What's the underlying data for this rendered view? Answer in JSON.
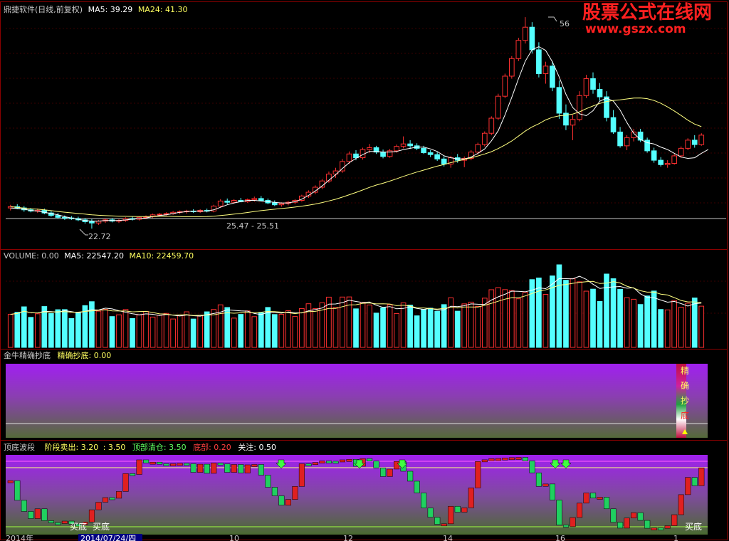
{
  "watermark": {
    "title": "股票公式在线网",
    "url": "www.gszx.com"
  },
  "panel_main": {
    "title": "鼎捷软件(日线,前复权)",
    "ma5_label": "MA5: 39.29",
    "ma24_label": "MA24: 41.30",
    "annotation_range": "25.47 - 25.51",
    "annotation_low": "22.72",
    "annotation_high": "56",
    "colors": {
      "ma5": "#ffffff",
      "ma24": "#ffff80",
      "up": "#ff3030",
      "down": "#54ffff"
    }
  },
  "panel_volume": {
    "title": "VOLUME: 0.00",
    "ma5_label": "MA5: 22547.20",
    "ma10_label": "MA10: 22459.70"
  },
  "panel_jingque": {
    "title": "金牛精确抄底",
    "value_label": "精确抄底: 0.00",
    "side_chars": [
      "精",
      "确",
      "抄",
      "底"
    ]
  },
  "panel_wave": {
    "title": "顶底波段",
    "stage_sell_label": "阶段卖出: 3.20",
    "stage_sell_value": ": 3.50",
    "top_clear_label": "顶部清仓: 3.50",
    "bottom_label": "底部: 0.20",
    "watch_label": "关注: 0.50",
    "buy_labels": [
      "买底",
      "买底",
      "买底"
    ]
  },
  "x_axis": {
    "labels": [
      "2014年",
      "2014/07/24/四",
      "10",
      "12",
      "14",
      "16",
      "1"
    ]
  },
  "chart_data": {
    "type": "candlestick",
    "candles_ohlc": [
      [
        26,
        26.5,
        25.6,
        26.2
      ],
      [
        26.2,
        26.6,
        25.8,
        26
      ],
      [
        26,
        26.3,
        25.4,
        25.7
      ],
      [
        25.7,
        26,
        25.3,
        25.5
      ],
      [
        25.5,
        25.9,
        25.2,
        25.6
      ],
      [
        25.6,
        25.9,
        25,
        25.2
      ],
      [
        25.2,
        25.5,
        24.6,
        24.8
      ],
      [
        24.8,
        25.2,
        24.3,
        24.5
      ],
      [
        24.5,
        24.8,
        24.1,
        24.4
      ],
      [
        24.4,
        24.7,
        24.1,
        24.3
      ],
      [
        24.3,
        24.6,
        23.9,
        24.1
      ],
      [
        24.1,
        24.4,
        23.5,
        23.8
      ],
      [
        23.8,
        24.2,
        22.7,
        23.6
      ],
      [
        23.6,
        24.1,
        23.3,
        23.9
      ],
      [
        23.9,
        24.3,
        23.6,
        24.1
      ],
      [
        24.1,
        24.4,
        23.7,
        23.9
      ],
      [
        23.9,
        24.2,
        23.6,
        24
      ],
      [
        24,
        24.5,
        23.8,
        24.3
      ],
      [
        24.3,
        24.6,
        24,
        24.2
      ],
      [
        24.2,
        24.6,
        24,
        24.5
      ],
      [
        24.5,
        24.8,
        24.2,
        24.6
      ],
      [
        24.6,
        25.1,
        24.4,
        24.9
      ],
      [
        24.9,
        25.2,
        24.6,
        25
      ],
      [
        25,
        25.3,
        24.8,
        25.1
      ],
      [
        25.1,
        25.5,
        24.9,
        25.3
      ],
      [
        25.3,
        25.6,
        25,
        25.4
      ],
      [
        25.4,
        25.7,
        25.1,
        25.5
      ],
      [
        25.5,
        25.8,
        25.2,
        25.4
      ],
      [
        25.4,
        25.8,
        25.2,
        25.6
      ],
      [
        25.6,
        25.9,
        25.3,
        25.5
      ],
      [
        25.5,
        26.5,
        25.3,
        26.3
      ],
      [
        26.3,
        27.4,
        26.1,
        27.1
      ],
      [
        27.1,
        27.5,
        26.6,
        26.9
      ],
      [
        26.9,
        27.4,
        26.7,
        27.2
      ],
      [
        27.2,
        27.6,
        26.9,
        27
      ],
      [
        27,
        27.5,
        26.8,
        27.3
      ],
      [
        27.3,
        27.8,
        27,
        27.5
      ],
      [
        27.5,
        27.9,
        27.1,
        27.2
      ],
      [
        27.2,
        27.5,
        26.6,
        26.8
      ],
      [
        26.8,
        27.2,
        26.3,
        26.5
      ],
      [
        26.5,
        26.9,
        26.2,
        26.7
      ],
      [
        26.7,
        27.1,
        26.4,
        26.9
      ],
      [
        26.9,
        27.4,
        26.6,
        27.2
      ],
      [
        27.2,
        28.1,
        27,
        27.9
      ],
      [
        27.9,
        28.8,
        27.6,
        28.5
      ],
      [
        28.5,
        29.6,
        28.2,
        29.3
      ],
      [
        29.3,
        30.6,
        29,
        30.3
      ],
      [
        30.3,
        31.8,
        30,
        31.4
      ],
      [
        31.4,
        32.4,
        30.8,
        31.9
      ],
      [
        31.9,
        33.8,
        31.6,
        33.4
      ],
      [
        33.4,
        35,
        33,
        34.6
      ],
      [
        34.6,
        35.2,
        33.6,
        34
      ],
      [
        34,
        35.6,
        33.7,
        35.3
      ],
      [
        35.3,
        36.2,
        34.8,
        35.6
      ],
      [
        35.6,
        35.9,
        34.6,
        34.9
      ],
      [
        34.9,
        35.3,
        33.9,
        34.2
      ],
      [
        34.2,
        35.4,
        34,
        35.1
      ],
      [
        35.1,
        36.1,
        34.8,
        35.8
      ],
      [
        35.8,
        37.4,
        35.5,
        36.2
      ],
      [
        36.2,
        36.8,
        35.4,
        35.9
      ],
      [
        35.9,
        36.3,
        35.2,
        35.5
      ],
      [
        35.5,
        35.9,
        34.6,
        34.8
      ],
      [
        34.8,
        35.2,
        34.1,
        34.5
      ],
      [
        34.5,
        34.9,
        33.5,
        33.8
      ],
      [
        33.8,
        34.2,
        32.6,
        33
      ],
      [
        33,
        34.3,
        32.4,
        34
      ],
      [
        34,
        34.6,
        33.2,
        33.6
      ],
      [
        33.6,
        34.2,
        32.5,
        33.9
      ],
      [
        33.9,
        35.2,
        33.6,
        34.9
      ],
      [
        34.9,
        36.4,
        34.5,
        36.1
      ],
      [
        36.1,
        38.2,
        35.8,
        37.9
      ],
      [
        37.9,
        40.6,
        37.6,
        40.3
      ],
      [
        40.3,
        44.2,
        40,
        43.8
      ],
      [
        43.8,
        47.4,
        43.5,
        47
      ],
      [
        47,
        50.2,
        46.6,
        49.8
      ],
      [
        49.8,
        53.1,
        49.4,
        52.7
      ],
      [
        52.7,
        56.4,
        52.2,
        54.8
      ],
      [
        54.8,
        55.6,
        50.6,
        51.2
      ],
      [
        51.2,
        52.4,
        46.8,
        47.4
      ],
      [
        47.4,
        49.3,
        45.8,
        48.6
      ],
      [
        48.6,
        49.4,
        44.6,
        45.2
      ],
      [
        45.2,
        46.3,
        40.2,
        41.1
      ],
      [
        41.1,
        42.5,
        38.4,
        39.2
      ],
      [
        39.2,
        40.8,
        36.8,
        40.1
      ],
      [
        40.1,
        44.6,
        39.8,
        43.9
      ],
      [
        43.9,
        47.2,
        43.5,
        46.6
      ],
      [
        46.6,
        47.6,
        44.2,
        44.9
      ],
      [
        44.9,
        45.9,
        43.1,
        43.7
      ],
      [
        43.7,
        44.6,
        39.8,
        40.4
      ],
      [
        40.4,
        41.6,
        37.8,
        38.1
      ],
      [
        38.1,
        38.9,
        35.6,
        35.9
      ],
      [
        35.9,
        37.6,
        35.2,
        37.2
      ],
      [
        37.2,
        38.6,
        36.6,
        38.1
      ],
      [
        38.1,
        38.6,
        36.5,
        36.8
      ],
      [
        36.8,
        37.2,
        34.8,
        35.1
      ],
      [
        35.1,
        35.6,
        33.2,
        33.6
      ],
      [
        33.6,
        34.1,
        32.6,
        32.9
      ],
      [
        32.9,
        33.6,
        32.4,
        33.1
      ],
      [
        33.1,
        34.6,
        32.9,
        34.3
      ],
      [
        34.3,
        35.8,
        34,
        35.5
      ],
      [
        35.5,
        37.1,
        35.2,
        36.8
      ],
      [
        36.8,
        37.6,
        35.6,
        36.1
      ],
      [
        36.1,
        37.9,
        35.9,
        37.6
      ]
    ],
    "ma5": [
      26,
      25.9,
      25.8,
      25.6,
      25.5,
      25.3,
      25.1,
      24.9,
      24.6,
      24.4,
      24.2,
      24,
      23.9,
      23.9,
      24,
      24,
      24,
      24.1,
      24.2,
      24.3,
      24.4,
      24.6,
      24.8,
      24.9,
      25.1,
      25.3,
      25.4,
      25.5,
      25.5,
      25.5,
      25.7,
      26.1,
      26.5,
      26.8,
      27,
      27.2,
      27.2,
      27.1,
      27,
      26.9,
      26.8,
      26.8,
      27,
      27.4,
      28,
      28.7,
      29.5,
      30.4,
      31.3,
      32.3,
      33.2,
      33.9,
      34.5,
      35,
      35,
      34.9,
      34.9,
      35,
      35.3,
      35.5,
      35.7,
      35.7,
      35.4,
      35,
      34.3,
      34,
      33.8,
      33.8,
      34.1,
      34.7,
      35.4,
      36.7,
      38.3,
      40.8,
      43.6,
      46.6,
      49.4,
      51.2,
      51.7,
      51.1,
      49.3,
      46.9,
      44.1,
      42,
      41,
      40.7,
      41.5,
      43,
      43.5,
      43,
      41.6,
      39.6,
      37.9,
      36.9,
      36.4,
      36.2,
      35.7,
      35.3,
      34.7,
      34.1,
      33.9,
      34,
      34.7,
      35.3
    ]
  }
}
